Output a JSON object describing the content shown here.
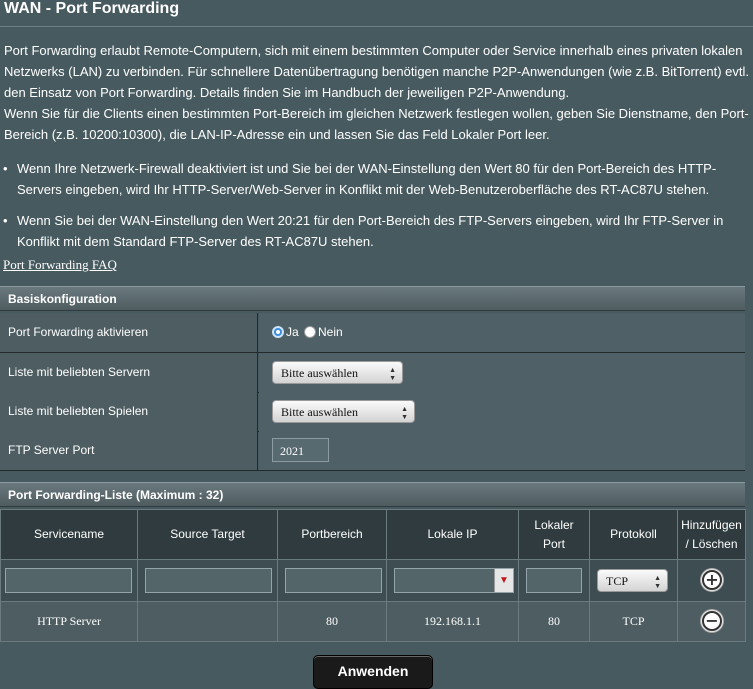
{
  "page": {
    "title": "WAN - Port Forwarding",
    "description": [
      "Port Forwarding erlaubt Remote-Computern, sich mit einem bestimmten Computer oder Service innerhalb eines privaten lokalen Netzwerks (LAN) zu verbinden. Für schnellere Datenübertragung benötigen manche P2P-Anwendungen (wie z.B. BitTorrent) evtl. den Einsatz von Port Forwarding. Details finden Sie im Handbuch der jeweiligen P2P-Anwendung.",
      "Wenn Sie für die Clients einen bestimmten Port-Bereich im gleichen Netzwerk festlegen wollen, geben Sie Dienstname, den Port-Bereich (z.B. 10200:10300), die LAN-IP-Adresse ein und lassen Sie das Feld Lokaler Port leer."
    ],
    "bullets": [
      "Wenn Ihre Netzwerk-Firewall deaktiviert ist und Sie bei der WAN-Einstellung den Wert 80 für den Port-Bereich des HTTP-Servers eingeben, wird Ihr HTTP-Server/Web-Server in Konflikt mit der Web-Benutzeroberfläche des RT-AC87U stehen.",
      "Wenn Sie bei der WAN-Einstellung den Wert 20:21 für den Port-Bereich des FTP-Servers eingeben, wird Ihr FTP-Server in Konflikt mit dem Standard FTP-Server des RT-AC87U stehen."
    ],
    "faq_link": "Port Forwarding FAQ"
  },
  "basic": {
    "header": "Basiskonfiguration",
    "enable_label": "Port Forwarding aktivieren",
    "radio_yes": "Ja",
    "radio_no": "Nein",
    "enabled": true,
    "servers_label": "Liste mit beliebten Servern",
    "servers_value": "Bitte auswählen",
    "games_label": "Liste mit beliebten Spielen",
    "games_value": "Bitte auswählen",
    "ftp_label": "FTP Server Port",
    "ftp_value": "2021"
  },
  "list": {
    "header": "Port Forwarding-Liste (Maximum : 32)",
    "columns": {
      "service": "Servicename",
      "source": "Source Target",
      "port_range": "Portbereich",
      "local_ip": "Lokale IP",
      "local_port_1": "Lokaler",
      "local_port_2": "Port",
      "protocol": "Protokoll",
      "add_del_1": "Hinzufügen",
      "add_del_2": "/ Löschen"
    },
    "new_protocol": "TCP",
    "rows": [
      {
        "service": "HTTP Server",
        "source": "",
        "port_range": "80",
        "local_ip": "192.168.1.1",
        "local_port": "80",
        "protocol": "TCP"
      }
    ]
  },
  "apply_label": "Anwenden",
  "icons": {
    "add": "plus-circle-icon",
    "delete": "minus-circle-icon",
    "dropdown": "chevron-down-icon"
  }
}
